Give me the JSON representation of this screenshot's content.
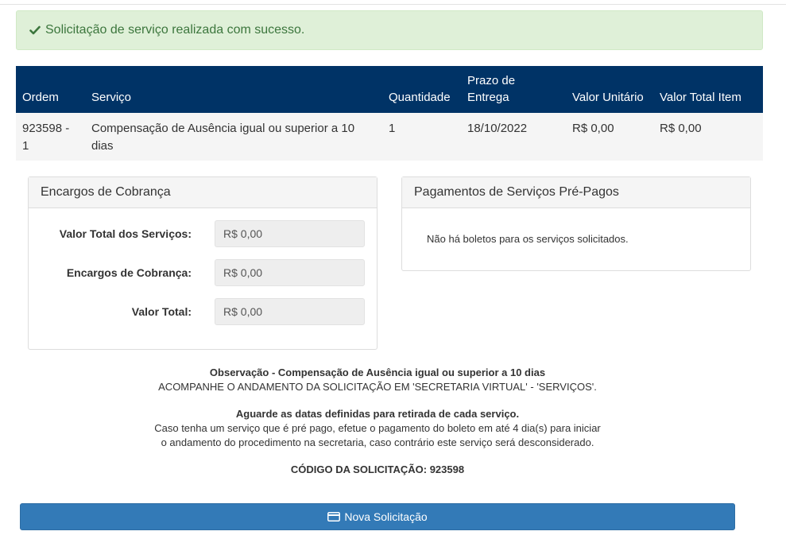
{
  "alert": {
    "message": "Solicitação de serviço realizada com sucesso.",
    "icon": "check-icon",
    "color": "#3c763d",
    "bg": "#dff0d8"
  },
  "table": {
    "header_bg": "#003366",
    "columns": [
      "Ordem",
      "Serviço",
      "Quantidade",
      "Prazo de Entrega",
      "Valor Unitário",
      "Valor Total Item"
    ],
    "rows": [
      [
        "923598 - 1",
        "Compensação de Ausência igual ou superior a 10 dias",
        "1",
        "18/10/2022",
        "R$ 0,00",
        "R$ 0,00"
      ]
    ]
  },
  "encargos": {
    "title": "Encargos de Cobrança",
    "fields": [
      {
        "label": "Valor Total dos Serviços:",
        "value": "R$ 0,00"
      },
      {
        "label": "Encargos de Cobrança:",
        "value": "R$ 0,00"
      },
      {
        "label": "Valor Total:",
        "value": "R$ 0,00"
      }
    ]
  },
  "pagamentos": {
    "title": "Pagamentos de Serviços Pré-Pagos",
    "message": "Não há boletos para os serviços solicitados."
  },
  "notes": {
    "observacao_title": "Observação - Compensação de Ausência igual ou superior a 10 dias",
    "observacao_text": "ACOMPANHE O ANDAMENTO DA SOLICITAÇÃO EM 'SECRETARIA VIRTUAL' - 'SERVIÇOS'.",
    "aguarde_title": "Aguarde as datas definidas para retirada de cada serviço.",
    "aguarde_line1": "Caso tenha um serviço que é pré pago, efetue o pagamento do boleto em até 4 dia(s) para iniciar",
    "aguarde_line2": "o andamento do procedimento na secretaria, caso contrário este serviço será desconsiderado.",
    "codigo": "CÓDIGO DA SOLICITAÇÃO: 923598"
  },
  "button": {
    "label": "Nova Solicitação",
    "icon": "credit-card-icon",
    "color": "#337ab7"
  }
}
